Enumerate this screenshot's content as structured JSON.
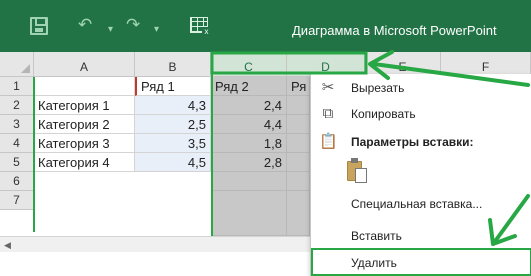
{
  "window": {
    "title": "Диаграмма в Microsoft PowerPoint"
  },
  "toolbar": {
    "undo_glyph": "↶",
    "redo_glyph": "↷",
    "dropdown_glyph": "▾"
  },
  "columns": [
    "A",
    "B",
    "C",
    "D",
    "E",
    "F"
  ],
  "rows": [
    "1",
    "2",
    "3",
    "4",
    "5",
    "6",
    "7"
  ],
  "table": {
    "headers": [
      "",
      "Ряд 1",
      "Ряд 2",
      "Ря"
    ],
    "categories": [
      "Категория 1",
      "Категория 2",
      "Категория 3",
      "Категория 4"
    ],
    "series1": [
      "4,3",
      "2,5",
      "3,5",
      "4,5"
    ],
    "series2": [
      "2,4",
      "4,4",
      "1,8",
      "2,8"
    ]
  },
  "scroll": {
    "left_glyph": "◀"
  },
  "context_menu": {
    "items": [
      {
        "label": "Вырезать",
        "icon": "scissors-icon",
        "glyph": "✂"
      },
      {
        "label": "Копировать",
        "icon": "copy-icon",
        "glyph": "⧉"
      },
      {
        "label": "Параметры вставки:",
        "icon": "paste-icon",
        "glyph": "📋"
      },
      {
        "label": "Специальная вставка...",
        "icon": "",
        "glyph": ""
      },
      {
        "label": "Вставить",
        "icon": "",
        "glyph": ""
      },
      {
        "label": "Удалить",
        "icon": "",
        "glyph": ""
      }
    ]
  },
  "colors": {
    "ribbon": "#217346",
    "highlight_arrow": "#28a745"
  }
}
